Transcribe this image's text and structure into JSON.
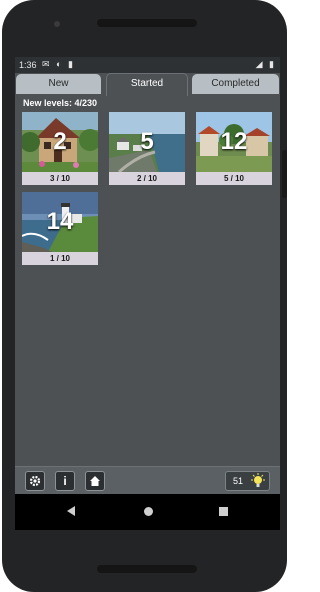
{
  "status_bar": {
    "time": "1:36",
    "left_icons": "✉ ◐ ▮",
    "right_icons": "◢ ▮"
  },
  "tabs": [
    {
      "label": "New",
      "selected": false
    },
    {
      "label": "Started",
      "selected": true
    },
    {
      "label": "Completed",
      "selected": false
    }
  ],
  "new_levels_text": "New levels:  4/230",
  "levels": [
    {
      "number": "2",
      "progress": "3 / 10",
      "scene": "house-garden"
    },
    {
      "number": "5",
      "progress": "2 / 10",
      "scene": "coastal-village"
    },
    {
      "number": "12",
      "progress": "5 / 10",
      "scene": "village-square"
    },
    {
      "number": "14",
      "progress": "1 / 10",
      "scene": "lighthouse-coast"
    }
  ],
  "bottom_bar": {
    "settings_icon": "gear-icon",
    "info_icon": "info-icon",
    "home_icon": "home-icon",
    "coins": "51",
    "hint_icon": "lightbulb-icon"
  },
  "colors": {
    "screen_bg": "#4d5154",
    "tab_inactive": "#b7bfc4",
    "progress_bg": "#d8d3dc"
  }
}
